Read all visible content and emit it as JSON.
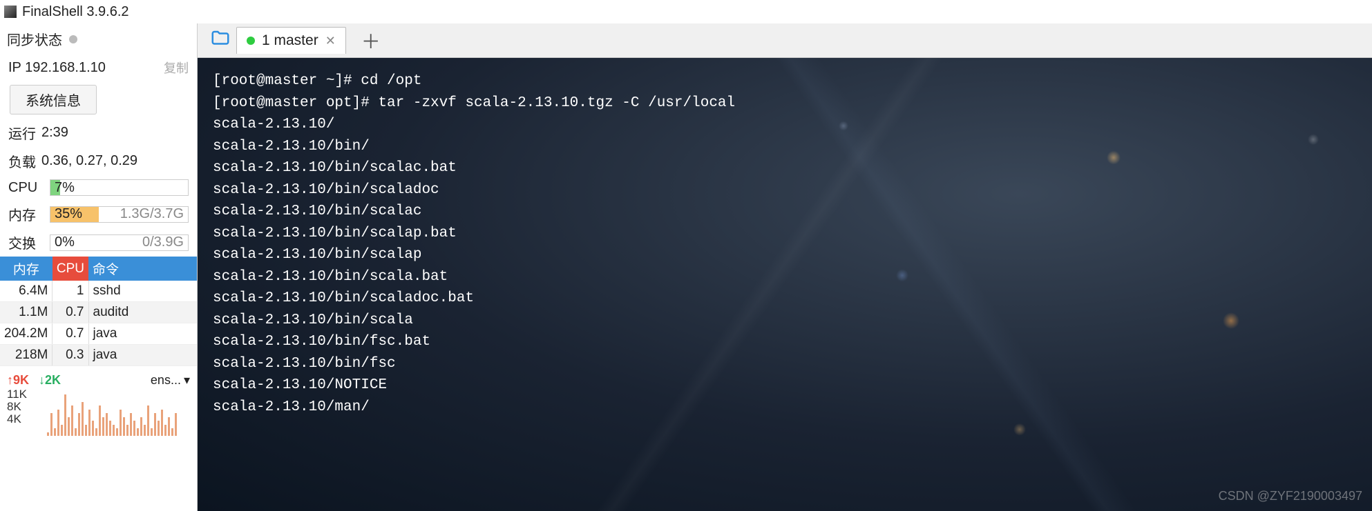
{
  "app_title": "FinalShell 3.9.6.2",
  "sidebar": {
    "sync_label": "同步状态",
    "ip_label": "IP",
    "ip_value": "192.168.1.10",
    "copy_label": "复制",
    "sysinfo_btn": "系统信息",
    "uptime_label": "运行",
    "uptime_value": "2:39",
    "load_label": "负载",
    "load_value": "0.36, 0.27, 0.29",
    "cpu_label": "CPU",
    "cpu_pct": "7%",
    "cpu_width": "7%",
    "mem_label": "内存",
    "mem_pct": "35%",
    "mem_extra": "1.3G/3.7G",
    "mem_width": "35%",
    "swap_label": "交换",
    "swap_pct": "0%",
    "swap_extra": "0/3.9G",
    "swap_width": "0%",
    "table_headers": {
      "mem": "内存",
      "cpu": "CPU",
      "cmd": "命令"
    },
    "procs": [
      {
        "mem": "6.4M",
        "cpu": "1",
        "cmd": "sshd"
      },
      {
        "mem": "1.1M",
        "cpu": "0.7",
        "cmd": "auditd"
      },
      {
        "mem": "204.2M",
        "cpu": "0.7",
        "cmd": "java"
      },
      {
        "mem": "218M",
        "cpu": "0.3",
        "cmd": "java"
      }
    ],
    "net_up": "9K",
    "net_down": "2K",
    "net_iface": "ens...",
    "y_ticks": [
      "11K",
      "8K",
      "4K"
    ]
  },
  "tabs": {
    "items": [
      {
        "label": "1 master",
        "active": true
      }
    ]
  },
  "terminal_lines": [
    "[root@master ~]# cd /opt",
    "[root@master opt]# tar -zxvf scala-2.13.10.tgz -C /usr/local",
    "scala-2.13.10/",
    "scala-2.13.10/bin/",
    "scala-2.13.10/bin/scalac.bat",
    "scala-2.13.10/bin/scaladoc",
    "scala-2.13.10/bin/scalac",
    "scala-2.13.10/bin/scalap.bat",
    "scala-2.13.10/bin/scalap",
    "scala-2.13.10/bin/scala.bat",
    "scala-2.13.10/bin/scaladoc.bat",
    "scala-2.13.10/bin/scala",
    "scala-2.13.10/bin/fsc.bat",
    "scala-2.13.10/bin/fsc",
    "scala-2.13.10/NOTICE",
    "scala-2.13.10/man/"
  ],
  "watermark": "CSDN @ZYF2190003497",
  "chart_data": {
    "type": "bar",
    "note": "network traffic sparkline, estimated heights",
    "values": [
      1,
      6,
      2,
      7,
      3,
      11,
      5,
      8,
      2,
      6,
      9,
      3,
      7,
      4,
      2,
      8,
      5,
      6,
      4,
      3,
      2,
      7,
      5,
      3,
      6,
      4,
      2,
      5,
      3,
      8,
      2,
      6,
      4,
      7,
      3,
      5,
      2,
      6
    ],
    "ylim": [
      0,
      11
    ],
    "y_ticks": [
      11,
      8,
      4
    ],
    "xlabel": "",
    "ylabel": "K"
  }
}
